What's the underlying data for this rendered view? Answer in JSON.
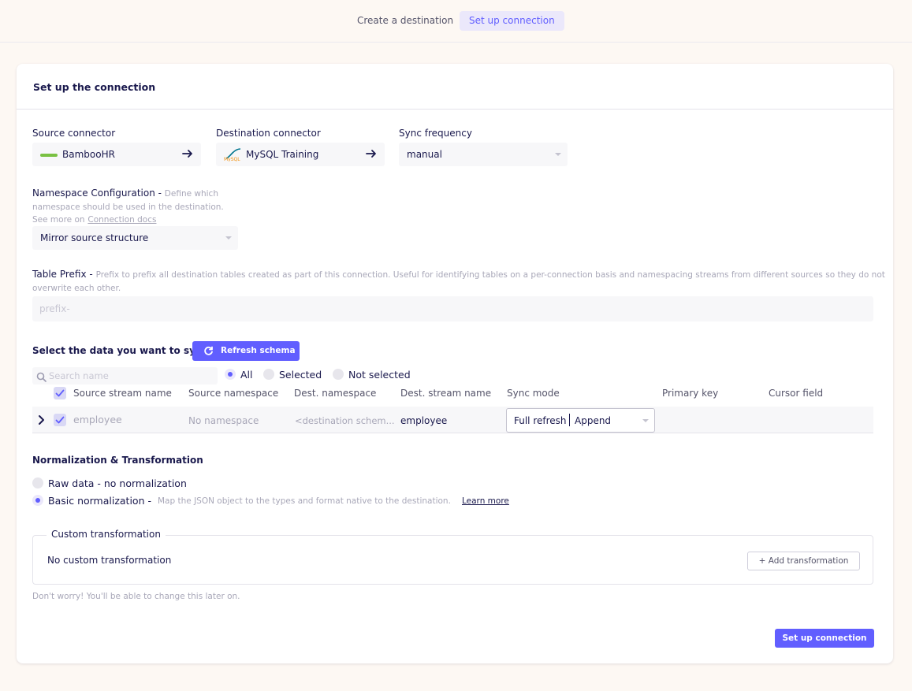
{
  "steps": [
    "Create a destination",
    "Set up connection"
  ],
  "card": {
    "title": "Set up the connection"
  },
  "source": {
    "label": "Source connector",
    "name": "BambooHR"
  },
  "destination": {
    "label": "Destination connector",
    "name": "MySQL Training"
  },
  "sync_frequency": {
    "label": "Sync frequency",
    "value": "manual"
  },
  "namespace": {
    "label": "Namespace Configuration -",
    "hint": "Define which namespace should be used in the destination.",
    "see_more": "See more on",
    "docs_link": "Connection docs",
    "value": "Mirror source structure"
  },
  "table_prefix": {
    "label": "Table Prefix -",
    "hint": "Prefix to prefix all destination tables created as part of this connection. Useful for identifying tables on a per-connection basis and namespacing streams from different sources so they do not overwrite each other.",
    "placeholder": "prefix-"
  },
  "streams": {
    "label": "Select the data you want to sync",
    "refresh": "Refresh schema",
    "search_placeholder": "Search name",
    "filters": [
      "All",
      "Selected",
      "Not selected"
    ],
    "columns": [
      "Source stream name",
      "Source namespace",
      "Dest. namespace",
      "Dest. stream name",
      "Sync mode",
      "Primary key",
      "Cursor field"
    ],
    "rows": [
      {
        "source": "employee",
        "namespace": "No namespace",
        "dest_namespace": "<destination schem...",
        "dest_stream": "employee",
        "sync_mode_a": "Full refresh",
        "sync_mode_b": "Append"
      }
    ]
  },
  "normalization": {
    "label": "Normalization & Transformation",
    "raw": "Raw data - no normalization",
    "basic": "Basic normalization -",
    "basic_hint": "Map the JSON object to the types and format native to the destination.",
    "learn_more": "Learn more"
  },
  "custom": {
    "legend": "Custom transformation",
    "empty": "No custom transformation",
    "add": "+ Add transformation"
  },
  "footer": {
    "note": "Don't worry! You'll be able to change this later on.",
    "submit": "Set up connection"
  },
  "colors": {
    "accent": "#615eff",
    "text": "#1a194d",
    "muted": "#a8a7b8"
  }
}
